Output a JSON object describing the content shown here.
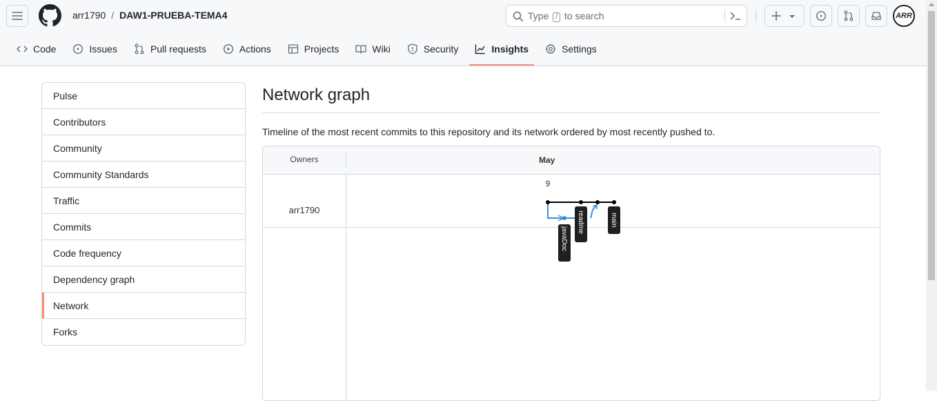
{
  "header": {
    "owner": "arr1790",
    "separator": "/",
    "repo": "DAW1-PRUEBA-TEMA4",
    "search": {
      "before": "Type",
      "key": "/",
      "after": "to search"
    },
    "avatar_text": "ARR",
    "plus_label": "+"
  },
  "tabs": [
    {
      "label": "Code",
      "icon": "code-icon"
    },
    {
      "label": "Issues",
      "icon": "issue-icon"
    },
    {
      "label": "Pull requests",
      "icon": "pull-request-icon"
    },
    {
      "label": "Actions",
      "icon": "play-icon"
    },
    {
      "label": "Projects",
      "icon": "table-icon"
    },
    {
      "label": "Wiki",
      "icon": "book-icon"
    },
    {
      "label": "Security",
      "icon": "shield-icon"
    },
    {
      "label": "Insights",
      "icon": "graph-icon",
      "active": true
    },
    {
      "label": "Settings",
      "icon": "gear-icon"
    }
  ],
  "sidebar": {
    "items": [
      {
        "label": "Pulse"
      },
      {
        "label": "Contributors"
      },
      {
        "label": "Community"
      },
      {
        "label": "Community Standards"
      },
      {
        "label": "Traffic"
      },
      {
        "label": "Commits"
      },
      {
        "label": "Code frequency"
      },
      {
        "label": "Dependency graph"
      },
      {
        "label": "Network",
        "selected": true
      },
      {
        "label": "Forks"
      }
    ]
  },
  "main": {
    "title": "Network graph",
    "description": "Timeline of the most recent commits to this repository and its network ordered by most recently pushed to."
  },
  "graph": {
    "owners_header": "Owners",
    "month": "May",
    "day": "9",
    "owner": "arr1790",
    "branches": [
      {
        "label": "javaDoc",
        "color": "#3b8fd6"
      },
      {
        "label": "readme",
        "color": "#000000"
      },
      {
        "label": "main",
        "color": "#000000"
      }
    ]
  },
  "colors": {
    "accent": "#fd8c73",
    "branch_blue": "#3b8fd6",
    "border": "#d0d7de"
  }
}
